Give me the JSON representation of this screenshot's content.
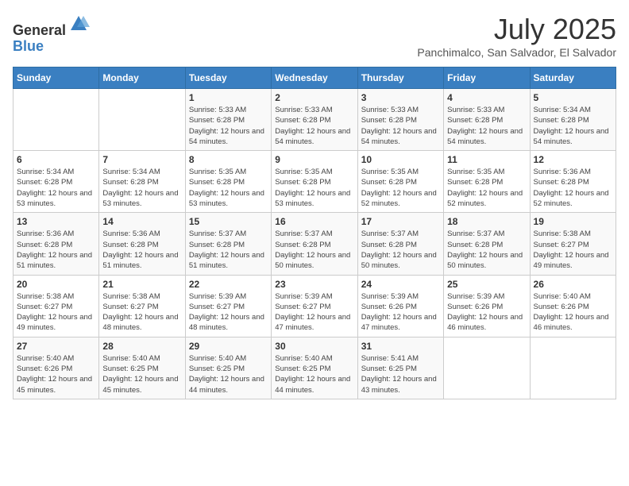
{
  "logo": {
    "text_general": "General",
    "text_blue": "Blue"
  },
  "title": "July 2025",
  "location": "Panchimalco, San Salvador, El Salvador",
  "days_of_week": [
    "Sunday",
    "Monday",
    "Tuesday",
    "Wednesday",
    "Thursday",
    "Friday",
    "Saturday"
  ],
  "weeks": [
    [
      {
        "day": "",
        "detail": ""
      },
      {
        "day": "",
        "detail": ""
      },
      {
        "day": "1",
        "detail": "Sunrise: 5:33 AM\nSunset: 6:28 PM\nDaylight: 12 hours and 54 minutes."
      },
      {
        "day": "2",
        "detail": "Sunrise: 5:33 AM\nSunset: 6:28 PM\nDaylight: 12 hours and 54 minutes."
      },
      {
        "day": "3",
        "detail": "Sunrise: 5:33 AM\nSunset: 6:28 PM\nDaylight: 12 hours and 54 minutes."
      },
      {
        "day": "4",
        "detail": "Sunrise: 5:33 AM\nSunset: 6:28 PM\nDaylight: 12 hours and 54 minutes."
      },
      {
        "day": "5",
        "detail": "Sunrise: 5:34 AM\nSunset: 6:28 PM\nDaylight: 12 hours and 54 minutes."
      }
    ],
    [
      {
        "day": "6",
        "detail": "Sunrise: 5:34 AM\nSunset: 6:28 PM\nDaylight: 12 hours and 53 minutes."
      },
      {
        "day": "7",
        "detail": "Sunrise: 5:34 AM\nSunset: 6:28 PM\nDaylight: 12 hours and 53 minutes."
      },
      {
        "day": "8",
        "detail": "Sunrise: 5:35 AM\nSunset: 6:28 PM\nDaylight: 12 hours and 53 minutes."
      },
      {
        "day": "9",
        "detail": "Sunrise: 5:35 AM\nSunset: 6:28 PM\nDaylight: 12 hours and 53 minutes."
      },
      {
        "day": "10",
        "detail": "Sunrise: 5:35 AM\nSunset: 6:28 PM\nDaylight: 12 hours and 52 minutes."
      },
      {
        "day": "11",
        "detail": "Sunrise: 5:35 AM\nSunset: 6:28 PM\nDaylight: 12 hours and 52 minutes."
      },
      {
        "day": "12",
        "detail": "Sunrise: 5:36 AM\nSunset: 6:28 PM\nDaylight: 12 hours and 52 minutes."
      }
    ],
    [
      {
        "day": "13",
        "detail": "Sunrise: 5:36 AM\nSunset: 6:28 PM\nDaylight: 12 hours and 51 minutes."
      },
      {
        "day": "14",
        "detail": "Sunrise: 5:36 AM\nSunset: 6:28 PM\nDaylight: 12 hours and 51 minutes."
      },
      {
        "day": "15",
        "detail": "Sunrise: 5:37 AM\nSunset: 6:28 PM\nDaylight: 12 hours and 51 minutes."
      },
      {
        "day": "16",
        "detail": "Sunrise: 5:37 AM\nSunset: 6:28 PM\nDaylight: 12 hours and 50 minutes."
      },
      {
        "day": "17",
        "detail": "Sunrise: 5:37 AM\nSunset: 6:28 PM\nDaylight: 12 hours and 50 minutes."
      },
      {
        "day": "18",
        "detail": "Sunrise: 5:37 AM\nSunset: 6:28 PM\nDaylight: 12 hours and 50 minutes."
      },
      {
        "day": "19",
        "detail": "Sunrise: 5:38 AM\nSunset: 6:27 PM\nDaylight: 12 hours and 49 minutes."
      }
    ],
    [
      {
        "day": "20",
        "detail": "Sunrise: 5:38 AM\nSunset: 6:27 PM\nDaylight: 12 hours and 49 minutes."
      },
      {
        "day": "21",
        "detail": "Sunrise: 5:38 AM\nSunset: 6:27 PM\nDaylight: 12 hours and 48 minutes."
      },
      {
        "day": "22",
        "detail": "Sunrise: 5:39 AM\nSunset: 6:27 PM\nDaylight: 12 hours and 48 minutes."
      },
      {
        "day": "23",
        "detail": "Sunrise: 5:39 AM\nSunset: 6:27 PM\nDaylight: 12 hours and 47 minutes."
      },
      {
        "day": "24",
        "detail": "Sunrise: 5:39 AM\nSunset: 6:26 PM\nDaylight: 12 hours and 47 minutes."
      },
      {
        "day": "25",
        "detail": "Sunrise: 5:39 AM\nSunset: 6:26 PM\nDaylight: 12 hours and 46 minutes."
      },
      {
        "day": "26",
        "detail": "Sunrise: 5:40 AM\nSunset: 6:26 PM\nDaylight: 12 hours and 46 minutes."
      }
    ],
    [
      {
        "day": "27",
        "detail": "Sunrise: 5:40 AM\nSunset: 6:26 PM\nDaylight: 12 hours and 45 minutes."
      },
      {
        "day": "28",
        "detail": "Sunrise: 5:40 AM\nSunset: 6:25 PM\nDaylight: 12 hours and 45 minutes."
      },
      {
        "day": "29",
        "detail": "Sunrise: 5:40 AM\nSunset: 6:25 PM\nDaylight: 12 hours and 44 minutes."
      },
      {
        "day": "30",
        "detail": "Sunrise: 5:40 AM\nSunset: 6:25 PM\nDaylight: 12 hours and 44 minutes."
      },
      {
        "day": "31",
        "detail": "Sunrise: 5:41 AM\nSunset: 6:25 PM\nDaylight: 12 hours and 43 minutes."
      },
      {
        "day": "",
        "detail": ""
      },
      {
        "day": "",
        "detail": ""
      }
    ]
  ]
}
